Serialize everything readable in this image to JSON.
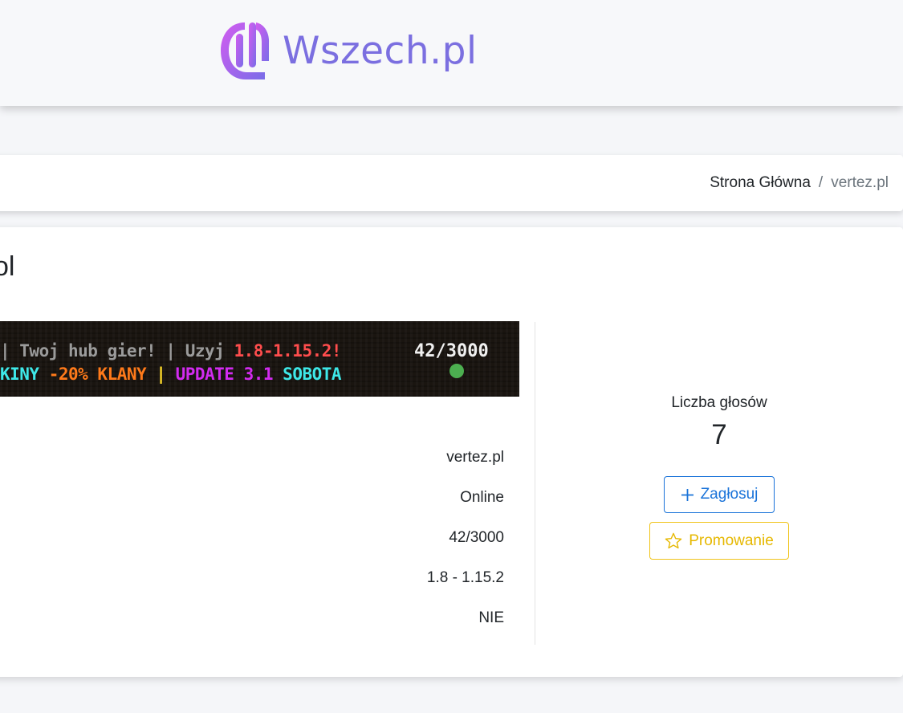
{
  "header": {
    "logo_text": "Wszech.pl"
  },
  "breadcrumb": {
    "home": "Strona Główna",
    "separator": "/",
    "current": "vertez.pl"
  },
  "server": {
    "title_fragment": "ol"
  },
  "banner": {
    "line1": [
      {
        "text": "| Twoj hub gier! | Uzyj ",
        "color": "gray"
      },
      {
        "text": "1.8-1.15.2!",
        "color": "red"
      }
    ],
    "line2": [
      {
        "text": "KINY ",
        "color": "aqua"
      },
      {
        "text": "-20% KLANY ",
        "color": "orange"
      },
      {
        "text": "| ",
        "color": "yellow"
      },
      {
        "text": "UPDATE 3.1 ",
        "color": "purple"
      },
      {
        "text": "SOBOTA",
        "color": "aqua"
      }
    ],
    "players": "42/3000",
    "status_color": "#4caf50"
  },
  "info": {
    "address": "vertez.pl",
    "status": "Online",
    "players": "42/3000",
    "version": "1.8 - 1.15.2",
    "premium": "NIE"
  },
  "votes": {
    "label": "Liczba głosów",
    "count": "7"
  },
  "buttons": {
    "vote": "Zagłosuj",
    "promote": "Promowanie"
  },
  "colors": {
    "primary": "#1a73d9",
    "warning": "#f0c419",
    "logo": "#7b6fe0"
  },
  "icons": {
    "vote": "plus-icon",
    "promote": "star-icon"
  }
}
